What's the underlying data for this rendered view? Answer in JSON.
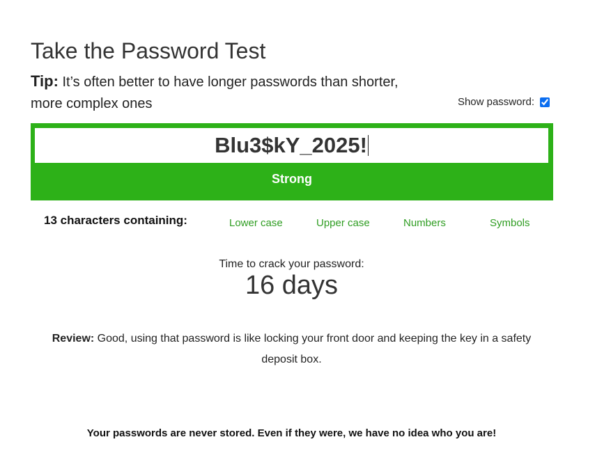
{
  "header": {
    "title": "Take the Password Test",
    "tip_label": "Tip:",
    "tip_text": " It’s often better to have longer passwords than shorter, more complex ones"
  },
  "show_password": {
    "label": "Show password:",
    "checked": true
  },
  "password": {
    "value": "Blu3$kY_2025!",
    "strength": "Strong",
    "meter_color": "#2db118"
  },
  "characters": {
    "summary": "13 characters containing:",
    "types": [
      "Lower case",
      "Upper case",
      "Numbers",
      "Symbols"
    ],
    "type_color": "#2f9d22"
  },
  "crack_time": {
    "label": "Time to crack your password:",
    "value": "16 days"
  },
  "review": {
    "label": "Review:",
    "text": " Good, using that password is like locking your front door and keeping the key in a safety deposit box."
  },
  "footer": {
    "text": "Your passwords are never stored. Even if they were, we have no idea who you are!"
  }
}
